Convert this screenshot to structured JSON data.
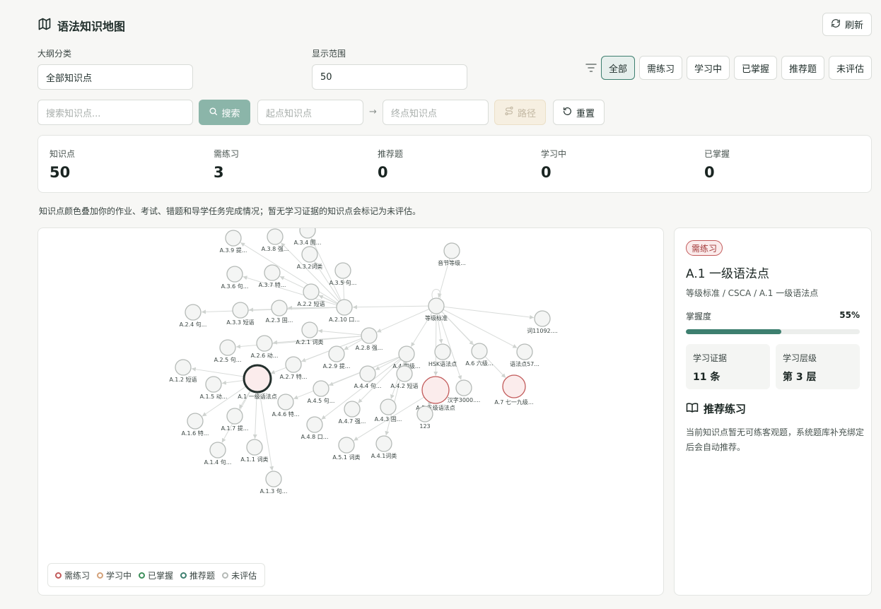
{
  "page": {
    "title": "语法知识地图",
    "refresh_label": "刷新"
  },
  "filters": {
    "outline_label": "大纲分类",
    "outline_value": "全部知识点",
    "range_label": "显示范围",
    "range_value": "50",
    "chips": [
      "全部",
      "需练习",
      "学习中",
      "已掌握",
      "推荐题",
      "未评估"
    ],
    "active_chip": "全部",
    "search_placeholder": "搜索知识点...",
    "search_label": "搜索",
    "start_placeholder": "起点知识点",
    "end_placeholder": "终点知识点",
    "path_label": "路径",
    "reset_label": "重置"
  },
  "stats": [
    {
      "label": "知识点",
      "value": "50"
    },
    {
      "label": "需练习",
      "value": "3"
    },
    {
      "label": "推荐题",
      "value": "0"
    },
    {
      "label": "学习中",
      "value": "0"
    },
    {
      "label": "已掌握",
      "value": "0"
    }
  ],
  "note": "知识点颜色叠加你的作业、考试、错题和导学任务完成情况；暂无学习证据的知识点会标记为未评估。",
  "graph": {
    "nodes": [
      {
        "id": "n1",
        "label": "A.3.4 固...",
        "status": "unassessed"
      },
      {
        "id": "n2",
        "label": "A.3.9 提...",
        "status": "unassessed"
      },
      {
        "id": "n3",
        "label": "A.3.8 强...",
        "status": "unassessed"
      },
      {
        "id": "n4",
        "label": "A.3.2词类",
        "status": "unassessed"
      },
      {
        "id": "n5",
        "label": "音节等级...",
        "status": "unassessed"
      },
      {
        "id": "n6",
        "label": "A.3.6 句...",
        "status": "unassessed"
      },
      {
        "id": "n7",
        "label": "A.3.7 特...",
        "status": "unassessed"
      },
      {
        "id": "n8",
        "label": "A.3.5 句...",
        "status": "unassessed"
      },
      {
        "id": "n9",
        "label": "A.2.2 短语",
        "status": "unassessed"
      },
      {
        "id": "n10",
        "label": "A.2.4 句...",
        "status": "unassessed"
      },
      {
        "id": "n11",
        "label": "A.3.3 短语",
        "status": "unassessed"
      },
      {
        "id": "n12",
        "label": "A.2.3 固...",
        "status": "unassessed"
      },
      {
        "id": "n13",
        "label": "A.2.10 口...",
        "status": "unassessed"
      },
      {
        "id": "n14",
        "label": "等级标准",
        "status": "unassessed"
      },
      {
        "id": "n15",
        "label": "词11092....",
        "status": "unassessed"
      },
      {
        "id": "n16",
        "label": "A.2.1 词类",
        "status": "unassessed"
      },
      {
        "id": "n17",
        "label": "A.2.8 强...",
        "status": "unassessed"
      },
      {
        "id": "n18",
        "label": "A.2.5 句...",
        "status": "unassessed"
      },
      {
        "id": "n19",
        "label": "A.2.6 动...",
        "status": "unassessed"
      },
      {
        "id": "n20",
        "label": "A.2.9 提...",
        "status": "unassessed"
      },
      {
        "id": "n21",
        "label": "A.4 四级...",
        "status": "unassessed"
      },
      {
        "id": "n22",
        "label": "HSK语法点",
        "status": "unassessed"
      },
      {
        "id": "n23",
        "label": "A.6 六级...",
        "status": "unassessed"
      },
      {
        "id": "n24",
        "label": "语法点57...",
        "status": "unassessed"
      },
      {
        "id": "n25",
        "label": "A.1.2 短语",
        "status": "unassessed"
      },
      {
        "id": "n26",
        "label": "A.1 一级语法点",
        "status": "practice"
      },
      {
        "id": "n27",
        "label": "A.2.7 特...",
        "status": "unassessed"
      },
      {
        "id": "n28",
        "label": "A.4.4 句...",
        "status": "unassessed"
      },
      {
        "id": "n29",
        "label": "A.4.2 短语",
        "status": "unassessed"
      },
      {
        "id": "n30",
        "label": "A.5 五级语法点",
        "status": "practice"
      },
      {
        "id": "n31",
        "label": "汉字3000....",
        "status": "unassessed"
      },
      {
        "id": "n32",
        "label": "A.7 七一九级...",
        "status": "practice"
      },
      {
        "id": "n33",
        "label": "A.1.5 动...",
        "status": "unassessed"
      },
      {
        "id": "n34",
        "label": "A.4.5 句...",
        "status": "unassessed"
      },
      {
        "id": "n35",
        "label": "A.4.6 特...",
        "status": "unassessed"
      },
      {
        "id": "n36",
        "label": "A.4.7 强...",
        "status": "unassessed"
      },
      {
        "id": "n37",
        "label": "A.4.3 固...",
        "status": "unassessed"
      },
      {
        "id": "n38",
        "label": "123",
        "status": "unassessed"
      },
      {
        "id": "n39",
        "label": "A.1.6 特...",
        "status": "unassessed"
      },
      {
        "id": "n40",
        "label": "A.1.7 提...",
        "status": "unassessed"
      },
      {
        "id": "n41",
        "label": "A.4.8 口...",
        "status": "unassessed"
      },
      {
        "id": "n42",
        "label": "A.1.4 句...",
        "status": "unassessed"
      },
      {
        "id": "n43",
        "label": "A.1.1 词类",
        "status": "unassessed"
      },
      {
        "id": "n44",
        "label": "A.5.1 词类",
        "status": "unassessed"
      },
      {
        "id": "n45",
        "label": "A.4.1词类",
        "status": "unassessed"
      },
      {
        "id": "n46",
        "label": "A.1.3 句...",
        "status": "unassessed"
      }
    ],
    "legend": [
      {
        "label": "需练习",
        "color": "#c25a5a"
      },
      {
        "label": "学习中",
        "color": "#d4a27a"
      },
      {
        "label": "已掌握",
        "color": "#3d8f5a"
      },
      {
        "label": "推荐题",
        "color": "#3d7f6f"
      },
      {
        "label": "未评估",
        "color": "#b5bab7"
      }
    ]
  },
  "detail": {
    "badge": "需练习",
    "title": "A.1 一级语法点",
    "breadcrumb": "等级标准 / CSCA / A.1 一级语法点",
    "mastery_label": "掌握度",
    "mastery_value": "55%",
    "mastery_fraction": 0.55,
    "evidence_label": "学习证据",
    "evidence_value": "11 条",
    "level_label": "学习层级",
    "level_value": "第 3 层",
    "practice_title": "推荐练习",
    "practice_desc": "当前知识点暂无可练客观题，系统题库补充绑定后会自动推荐。"
  }
}
